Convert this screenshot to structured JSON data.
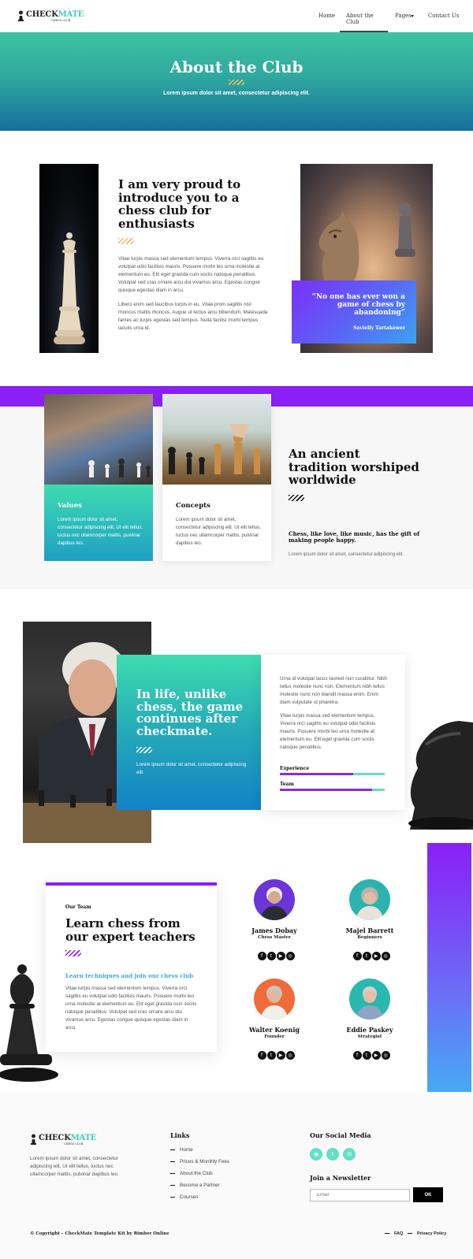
{
  "brand": {
    "name_dark": "CHECK",
    "name_accent": "MATE",
    "tagline": "CHESS CLUB",
    "accent": "#5fe0c7",
    "purple": "#8a1ff6"
  },
  "nav": {
    "items": [
      {
        "label": "Home"
      },
      {
        "label": "About the Club"
      },
      {
        "label": "Pages"
      },
      {
        "label": "Contact Us"
      }
    ],
    "active": "About the Club"
  },
  "hero": {
    "title": "About the Club",
    "subtitle": "Lorem ipsum dolor sit amet, consectetur adipiscing elit."
  },
  "intro": {
    "heading": "I am very proud to introduce you to a chess club for enthusiasts",
    "para1": "Vitae turpis massa sed elementum tempus. Viverra orci sagittis eu volutpat odio facilisis mauris. Posuere morbi leo urna molestie at elementum eu. Elit eget gravida cum sociis natoque penatibus. Volutpat sed cras ornare arcu dui vivamus arcu. Egestas congue quisque egestas diam in arcu.",
    "para2": "Libero enim sed faucibus turpis in eu. Vitae proin sagittis nisl rhoncus mattis rhoncus. Augue ut lectus arcu bibendum. Malesuada fames ac turpis egestas sed tempus. Nulla facilisi morbi tempus iaculis urna id.",
    "quote": "“No one has ever won a game of chess by abandoning”",
    "quote_author": "Savielly Tartakower"
  },
  "tradition": {
    "cards": [
      {
        "title": "Values",
        "text": "Lorem ipsum dolor sit amet, consectetur adipiscing elit. Ut elit tellus, luctus nec ullamcorper mattis, pulvinar dapibus leo."
      },
      {
        "title": "Concepts",
        "text": "Lorem ipsum dolor sit amet, consectetur adipiscing elit. Ut elit tellus, luctus nec ullamcorper mattis, pulvinar dapibus leo."
      }
    ],
    "heading": "An ancient tradition worshiped worldwide",
    "subheading": "Chess, like love, like music, has the gift of making people happy.",
    "small": "Lorem ipsum dolor sit amet, consectetur adipiscing elit."
  },
  "life": {
    "quote": "In life, unlike chess, the game continues after checkmate.",
    "quote_sub": "Lorem ipsum dolor sit amet, consectetur adipiscing elit.",
    "para1": "Urna id volutpat lacus laoreet non curabitur. Nibh tellus molestie nunc non. Elementum nibh tellus molestie nunc non blandit massa enim. Enim diam vulputate ut pharetra.",
    "para2": "Vitae turpis massa sed elementum tempus. Viverra orci sagittis eu volutpat odio facilisis mauris. Posuere morbi leo urna molestie at elementum eu. Elit eget gravida cum sociis natoque penatibus.",
    "bars": [
      {
        "label": "Experience",
        "value": 0.7
      },
      {
        "label": "Team",
        "value": 0.88
      }
    ]
  },
  "team": {
    "kicker": "Our Team",
    "heading": "Learn chess from our expert teachers",
    "link": "Learn techniques and join our chess club",
    "para": "Vitae turpis massa sed elementum tempus. Viverra orci sagittis eu volutpat odio facilisis mauris. Posuere morbi leo urna molestie at elementum eu. Elit eget gravida cum sociis natoque penatibus. Volutpat sed cras ornare arcu dui vivamus arcu. Egestas congue quisque egestas diam in arcu.",
    "members": [
      {
        "name": "James Dobay",
        "role": "Chess Master",
        "bg": "#6a35d9"
      },
      {
        "name": "Majel Barrett",
        "role": "Beginners",
        "bg": "#2bb3b0"
      },
      {
        "name": "Walter Koenig",
        "role": "Founder",
        "bg": "#f06a3a"
      },
      {
        "name": "Eddie Paskey",
        "role": "Strategist",
        "bg": "#28b8b0"
      }
    ]
  },
  "footer": {
    "about": "Lorem ipsum dolor sit amet, consectetur adipiscing elit. Ut elit tellus, luctus nec ullamcorper mattis, pulvinar dapibus leo.",
    "links_title": "Links",
    "links": [
      "Home",
      "Prices & Monthly Fees",
      "About the Club",
      "Become a Partner",
      "Courses"
    ],
    "social_title": "Our Social Media",
    "newsletter_title": "Join a Newsletter",
    "email_placeholder": "Email",
    "ok_label": "OK",
    "copyright": "© Copyright – CheckMate Template Kit by Rimber Online",
    "bottom_links": [
      "FAQ",
      "Privacy Policy"
    ]
  }
}
